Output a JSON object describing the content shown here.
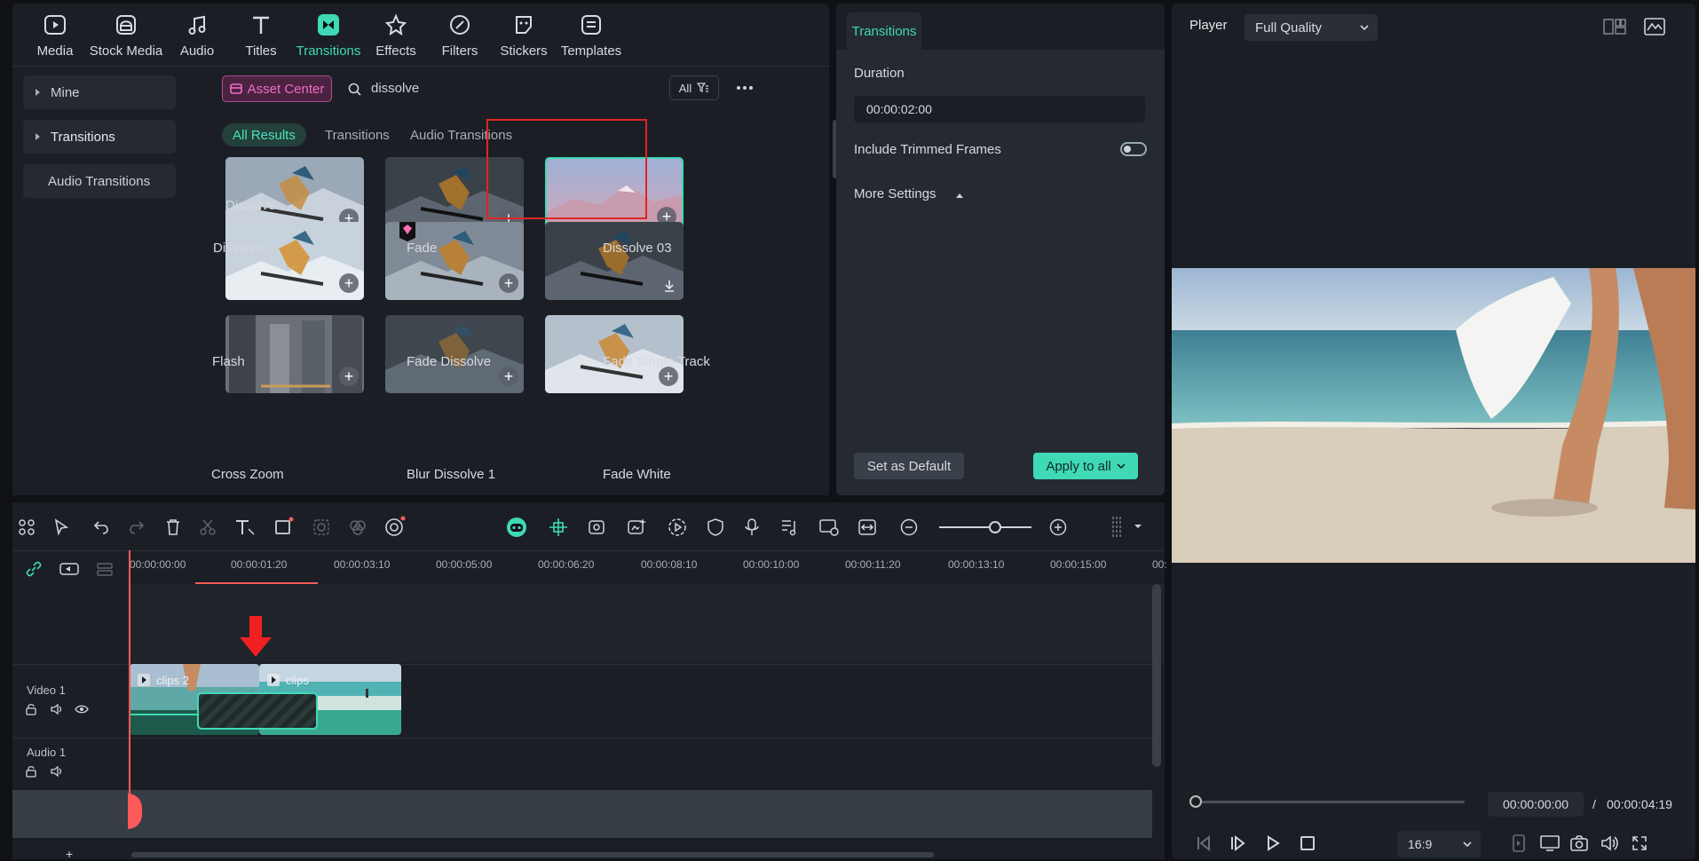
{
  "toolbar": {
    "items": [
      {
        "label": "Media"
      },
      {
        "label": "Stock Media"
      },
      {
        "label": "Audio"
      },
      {
        "label": "Titles"
      },
      {
        "label": "Transitions"
      },
      {
        "label": "Effects"
      },
      {
        "label": "Filters"
      },
      {
        "label": "Stickers"
      },
      {
        "label": "Templates"
      }
    ],
    "active": "Transitions",
    "accent": "#3fd9b6"
  },
  "sidebar": {
    "items": [
      {
        "label": "Mine"
      },
      {
        "label": "Transitions"
      },
      {
        "label": "Audio Transitions"
      }
    ]
  },
  "library": {
    "asset_center": "Asset Center",
    "search_value": "dissolve",
    "filter_label": "All",
    "tabs": [
      "All Results",
      "Transitions",
      "Audio Transitions"
    ],
    "active_tab": "All Results",
    "grid": [
      {
        "label": "Dissolve"
      },
      {
        "label": "Fade"
      },
      {
        "label": "Dissolve 03"
      },
      {
        "label": "Flash"
      },
      {
        "label": "Fade Dissolve"
      },
      {
        "label": "Fade Single Track"
      },
      {
        "label": "Cross Zoom"
      },
      {
        "label": "Blur Dissolve 1"
      },
      {
        "label": "Fade White"
      }
    ],
    "selected": "Dissolve 03",
    "highlight_color": "#e02424"
  },
  "properties": {
    "tab": "Transitions",
    "duration_label": "Duration",
    "duration_value": "00:00:02:00",
    "include_trimmed": "Include Trimmed Frames",
    "include_trimmed_on": false,
    "more_settings": "More Settings",
    "set_default": "Set as Default",
    "apply_all": "Apply to all"
  },
  "player": {
    "label": "Player",
    "quality": "Full Quality",
    "current_time": "00:00:00:00",
    "separator": "/",
    "total_time": "00:00:04:19",
    "ratio": "16:9"
  },
  "timeline": {
    "ruler": [
      "00:00:00:00",
      "00:00:01:20",
      "00:00:03:10",
      "00:00:05:00",
      "00:00:06:20",
      "00:00:08:10",
      "00:00:10:00",
      "00:00:11:20",
      "00:00:13:10",
      "00:00:15:00",
      "00:"
    ],
    "tracks": {
      "video": "Video 1",
      "audio": "Audio 1"
    },
    "clips": [
      {
        "label": "clips 2"
      },
      {
        "label": "clips"
      }
    ]
  }
}
